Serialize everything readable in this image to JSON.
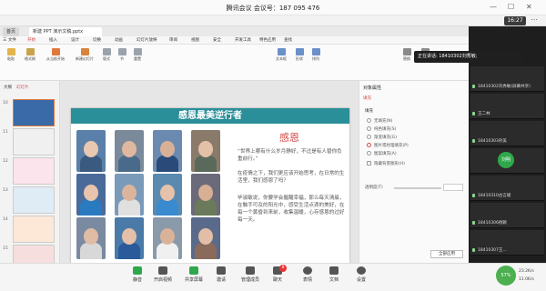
{
  "meeting": {
    "title": "腾讯会议 会议号：187 095 476",
    "time": "16:27",
    "share_status": "正在讲话: 18410302刘秀敏;"
  },
  "wps": {
    "tabs": [
      "首页",
      "新建 PPT 演示文稿.pptx"
    ],
    "menu": [
      "三 文件",
      "开始",
      "插入",
      "设计",
      "切换",
      "动画",
      "幻灯片放映",
      "审阅",
      "视图",
      "安全",
      "开发工具",
      "特色应用",
      "查找"
    ],
    "ribbon": [
      "粘贴",
      "格式刷",
      "从当前开始",
      "新建幻灯片",
      "版式",
      "节",
      "重置",
      "文本框",
      "形状",
      "排列",
      "替换",
      "选择"
    ],
    "panes": {
      "outline": "大纲",
      "slides": "幻灯片"
    },
    "props": {
      "title": "对象属性",
      "fill_tab": "填充",
      "fill_label": "填充",
      "options": [
        "无填充(N)",
        "纯色填充(S)",
        "渐变填充(G)",
        "图片或纹理填充(P)",
        "图案填充(A)",
        "隐藏背景图形(H)"
      ],
      "transparency": "透明度(T)",
      "apply_all": "全部应用"
    }
  },
  "slide": {
    "title": "感恩最美逆行者",
    "heading": "感恩",
    "p1": "“世界上哪有什么岁月静好，不过是有人替你负重前行。”",
    "p2": "在疫情之下，我们更应该开始思考，在日常的生活里，我们感恩了吗？",
    "p3": "毕淑敏说，你要学会握醒幸福，那么每天清晨，在触手可及的阳光中，感受生活点滴的美好，在每一个黄昏到来前，收集温暖，心存感恩的过好每一天。"
  },
  "thumbs": [
    "10",
    "11",
    "12",
    "13",
    "14",
    "15"
  ],
  "participants": [
    {
      "name": "18410302刘秀敏(屏幕共享)"
    },
    {
      "name": "王二林"
    },
    {
      "name": "18410303孙美"
    },
    {
      "name": "刘明"
    },
    {
      "name": "18410310古言峻"
    },
    {
      "name": "18410306杨颖"
    },
    {
      "name": "18410307王..."
    }
  ],
  "toolbar": {
    "items": [
      "静音",
      "开启视频",
      "共享屏幕",
      "邀请",
      "管理成员",
      "聊天",
      "表情",
      "文档",
      "设置"
    ],
    "chat_badge": "8",
    "network": "57%",
    "up": "23.2K/s",
    "down": "11.0K/s"
  },
  "colors": {
    "accent": "#2a8f98",
    "heading": "#d24a4a"
  }
}
